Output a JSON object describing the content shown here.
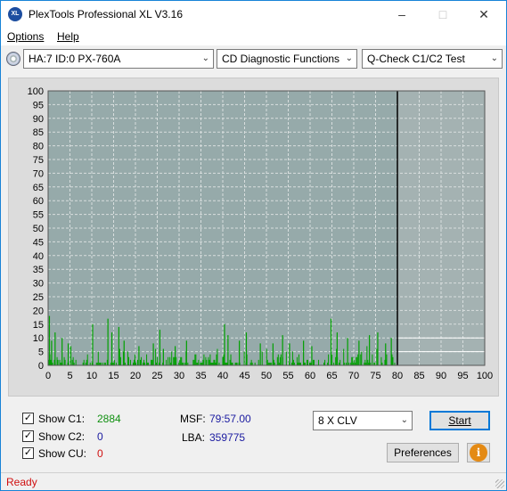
{
  "window": {
    "title": "PlexTools Professional XL V3.16",
    "app_icon_text": "XL"
  },
  "menu": {
    "items": [
      "Options",
      "Help"
    ]
  },
  "toolbar": {
    "drive": "HA:7 ID:0  PX-760A",
    "function": "CD Diagnostic Functions",
    "test": "Q-Check C1/C2 Test"
  },
  "chart_data": {
    "type": "bar",
    "x_ticks": [
      0,
      5,
      10,
      15,
      20,
      25,
      30,
      35,
      40,
      45,
      50,
      55,
      60,
      65,
      70,
      75,
      80,
      85,
      90,
      95,
      100
    ],
    "y_ticks": [
      0,
      5,
      10,
      15,
      20,
      25,
      30,
      35,
      40,
      45,
      50,
      55,
      60,
      65,
      70,
      75,
      80,
      85,
      90,
      95,
      100
    ],
    "xlim": [
      0,
      100
    ],
    "ylim": [
      0,
      100
    ],
    "scan_end_marker": 80,
    "series": [
      {
        "name": "C1",
        "color": "#00a000",
        "x_range": [
          0,
          80
        ],
        "peaks": [
          {
            "x": 0.3,
            "y": 18
          },
          {
            "x": 0.8,
            "y": 9
          },
          {
            "x": 1.6,
            "y": 12
          },
          {
            "x": 3.2,
            "y": 10
          },
          {
            "x": 4.6,
            "y": 8
          },
          {
            "x": 5.2,
            "y": 7
          },
          {
            "x": 10.2,
            "y": 15
          },
          {
            "x": 13.7,
            "y": 17
          },
          {
            "x": 14.6,
            "y": 12
          },
          {
            "x": 16.2,
            "y": 14
          },
          {
            "x": 17.4,
            "y": 9
          },
          {
            "x": 20.8,
            "y": 7
          },
          {
            "x": 24.1,
            "y": 8
          },
          {
            "x": 25.6,
            "y": 13
          },
          {
            "x": 26.4,
            "y": 6
          },
          {
            "x": 29.1,
            "y": 7
          },
          {
            "x": 31.7,
            "y": 9
          },
          {
            "x": 40.4,
            "y": 15
          },
          {
            "x": 41.2,
            "y": 11
          },
          {
            "x": 43.8,
            "y": 9
          },
          {
            "x": 45.4,
            "y": 12
          },
          {
            "x": 48.6,
            "y": 8
          },
          {
            "x": 51.5,
            "y": 8
          },
          {
            "x": 53.7,
            "y": 11
          },
          {
            "x": 55.3,
            "y": 8
          },
          {
            "x": 58.5,
            "y": 9
          },
          {
            "x": 60.4,
            "y": 7
          },
          {
            "x": 64.8,
            "y": 17
          },
          {
            "x": 66.2,
            "y": 12
          },
          {
            "x": 68.6,
            "y": 10
          },
          {
            "x": 71.2,
            "y": 9
          },
          {
            "x": 73.6,
            "y": 11
          },
          {
            "x": 75.5,
            "y": 12
          },
          {
            "x": 77.3,
            "y": 8
          },
          {
            "x": 78.6,
            "y": 10
          }
        ]
      }
    ]
  },
  "bottom": {
    "show_c1_label": "Show C1:",
    "c1_value": "2884",
    "show_c2_label": "Show C2:",
    "c2_value": "0",
    "show_cu_label": "Show CU:",
    "cu_value": "0",
    "msf_label": "MSF:",
    "msf_value": "79:57.00",
    "lba_label": "LBA:",
    "lba_value": "359775",
    "speed": "8 X CLV",
    "start_label": "Start",
    "preferences_label": "Preferences",
    "info_icon": "i"
  },
  "status": {
    "text": "Ready"
  },
  "colors": {
    "accent": "#0078d7",
    "c1": "#109010",
    "c2": "#1a1aa0",
    "cu": "#d01010"
  }
}
